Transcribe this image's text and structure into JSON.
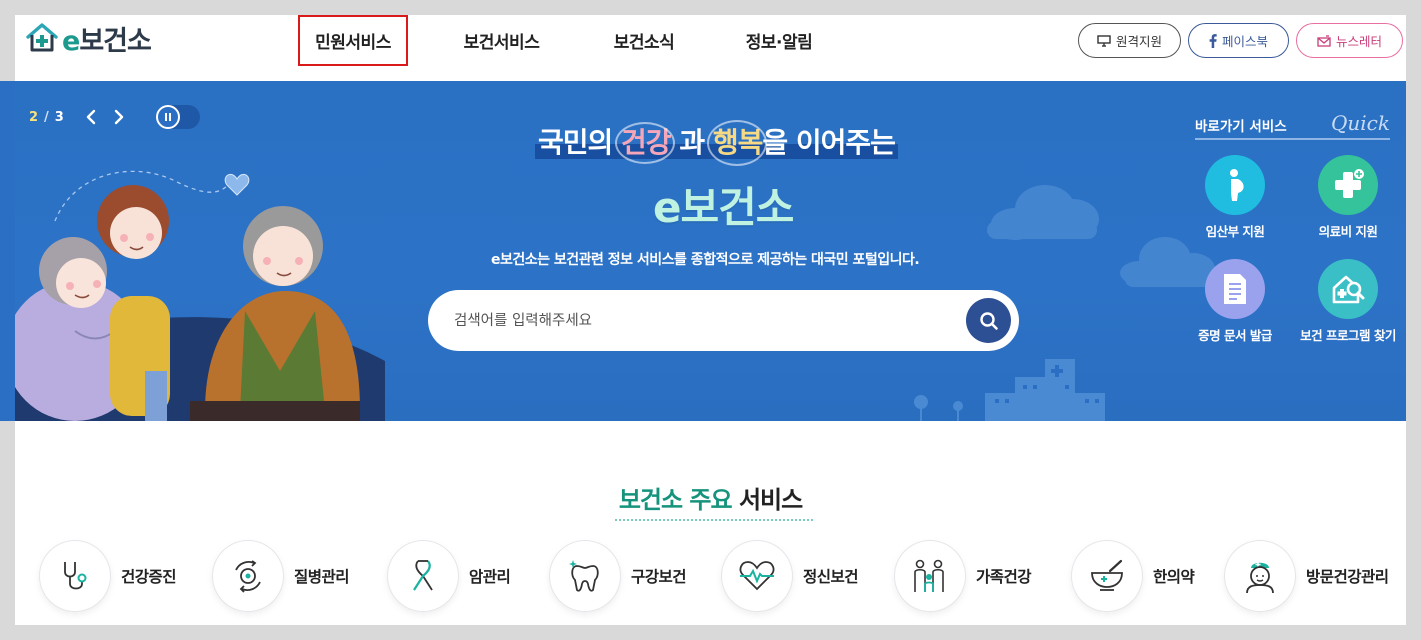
{
  "header": {
    "logo_text_e": "e",
    "logo_text_rest": "보건소",
    "nav": [
      {
        "label": "민원서비스",
        "active": true
      },
      {
        "label": "보건서비스",
        "active": false
      },
      {
        "label": "보건소식",
        "active": false
      },
      {
        "label": "정보·알림",
        "active": false
      }
    ],
    "util": {
      "remote_label": "원격지원",
      "facebook_label": "페이스북",
      "newsletter_label": "뉴스레터"
    }
  },
  "hero": {
    "pager_current": "2",
    "pager_sep": "/",
    "pager_total": "3",
    "headline_pre": "국민의",
    "headline_k1": "건강",
    "headline_mid": "과",
    "headline_k2": "행복",
    "headline_post": "을 이어주는",
    "brand": "e보건소",
    "description": "e보건소는 보건관련 정보 서비스를 종합적으로 제공하는 대국민 포털입니다.",
    "search_placeholder": "검색어를 입력해주세요"
  },
  "quick": {
    "title": "바로가기 서비스",
    "title_en": "Quick",
    "items": [
      {
        "label": "임산부 지원",
        "icon": "pregnant-icon",
        "color": "#20bde0"
      },
      {
        "label": "의료비 지원",
        "icon": "medical-cross-icon",
        "color": "#34c39a"
      },
      {
        "label": "증명 문서 발급",
        "icon": "document-icon",
        "color": "#9aa2ee"
      },
      {
        "label": "보건 프로그램 찾기",
        "icon": "house-search-icon",
        "color": "#3bbfc7"
      }
    ]
  },
  "services": {
    "title_green": "보건소 주요",
    "title_dark": "서비스",
    "items": [
      {
        "label": "건강증진",
        "icon": "stethoscope-icon"
      },
      {
        "label": "질병관리",
        "icon": "virus-icon"
      },
      {
        "label": "암관리",
        "icon": "ribbon-icon"
      },
      {
        "label": "구강보건",
        "icon": "tooth-icon"
      },
      {
        "label": "정신보건",
        "icon": "heart-pulse-icon"
      },
      {
        "label": "가족건강",
        "icon": "family-icon"
      },
      {
        "label": "한의약",
        "icon": "mortar-icon"
      },
      {
        "label": "방문건강관리",
        "icon": "nurse-icon"
      }
    ]
  },
  "colors": {
    "accent_green": "#16937d",
    "hero_blue": "#2a6fc3",
    "active_nav_outline": "#d81a1a"
  }
}
